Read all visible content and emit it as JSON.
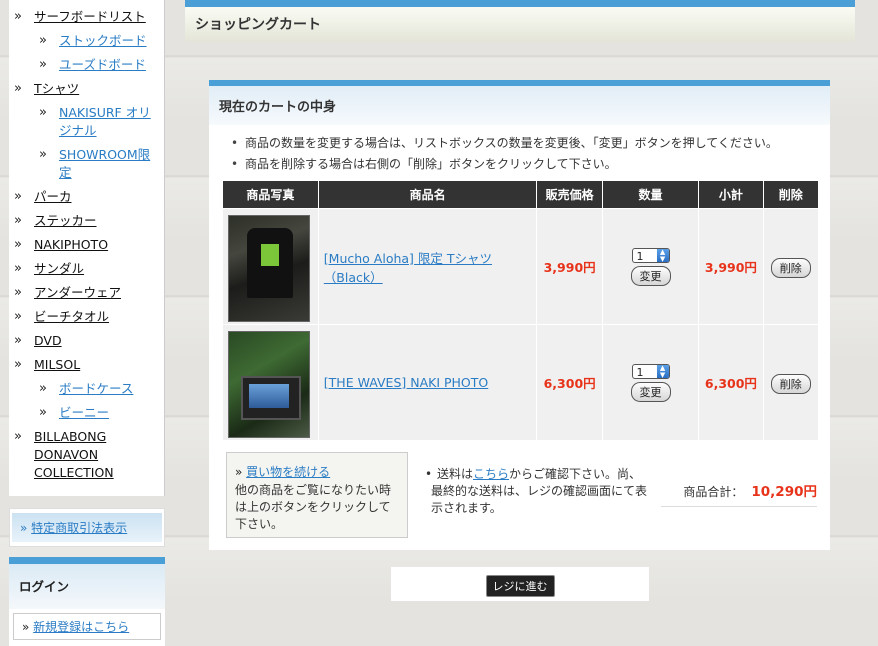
{
  "sidebar": {
    "items": [
      {
        "label": "サーフボードリスト"
      },
      {
        "label": "ストックボード"
      },
      {
        "label": "ユーズドボード"
      },
      {
        "label": "Tシャツ"
      },
      {
        "label": "NAKISURF オリジナル"
      },
      {
        "label": "SHOWROOM限定"
      },
      {
        "label": "パーカ"
      },
      {
        "label": "ステッカー"
      },
      {
        "label": "NAKIPHOTO"
      },
      {
        "label": "サンダル"
      },
      {
        "label": "アンダーウェア"
      },
      {
        "label": "ビーチタオル"
      },
      {
        "label": "DVD"
      },
      {
        "label": "MILSOL"
      },
      {
        "label": "ボードケース"
      },
      {
        "label": "ビーニー"
      },
      {
        "label": "BILLABONG DONAVON COLLECTION"
      }
    ],
    "tokutei_label": "特定商取引法表示",
    "login_heading": "ログイン",
    "register_link": "新規登録はこちら"
  },
  "page": {
    "title": "ショッピングカート"
  },
  "cart": {
    "heading": "現在のカートの中身",
    "notes": [
      "商品の数量を変更する場合は、リストボックスの数量を変更後、「変更」ボタンを押してください。",
      "商品を削除する場合は右側の「削除」ボタンをクリックして下さい。"
    ],
    "columns": [
      "商品写真",
      "商品名",
      "販売価格",
      "数量",
      "小計",
      "削除"
    ],
    "rows": [
      {
        "name": "[Mucho Aloha] 限定 Tシャツ（Black）",
        "price": "3,990円",
        "qty": "1",
        "subtotal": "3,990円",
        "change": "変更",
        "delete": "削除"
      },
      {
        "name": "[THE WAVES] NAKI PHOTO",
        "price": "6,300円",
        "qty": "1",
        "subtotal": "6,300円",
        "change": "変更",
        "delete": "削除"
      }
    ],
    "continue_link": "買い物を続ける",
    "continue_desc": "他の商品をご覧になりたい時は上のボタンをクリックして下さい。",
    "shipping_pre": "送料は",
    "shipping_link": "こちら",
    "shipping_post": "からご確認下さい。尚、最終的な送料は、レジの確認画面にて表示されます。",
    "total_label": "商品合計：",
    "total_value": "10,290円",
    "checkout_label": "レジに進む"
  },
  "colors": {
    "accent": "#4a9fd6",
    "price": "#e8331b",
    "link": "#2a7cc4"
  }
}
